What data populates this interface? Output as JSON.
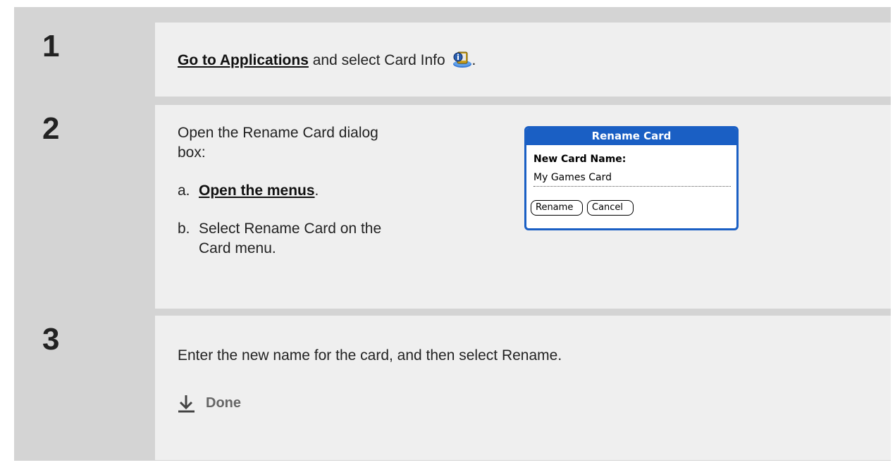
{
  "steps": [
    {
      "number": "1",
      "link_text": "Go to Applications",
      "text": " and select Card Info ",
      "icon": "card-info-icon",
      "trailing": "."
    },
    {
      "number": "2",
      "intro": "Open the Rename Card dialog box:",
      "sub_a_label": "a.",
      "sub_a_link": "Open the menus",
      "sub_a_trailing": ".",
      "sub_b_label": "b.",
      "sub_b_text": "Select Rename Card on the Card menu.",
      "dialog": {
        "title": "Rename Card",
        "field_label": "New Card Name:",
        "field_value": "My Games Card",
        "buttons": [
          "Rename",
          "Cancel"
        ],
        "accent_color": "#1a5fc4"
      }
    },
    {
      "number": "3",
      "text": "Enter the new name for the card, and then select Rename.",
      "done_label": "Done",
      "done_icon": "down-arrow-icon"
    }
  ]
}
